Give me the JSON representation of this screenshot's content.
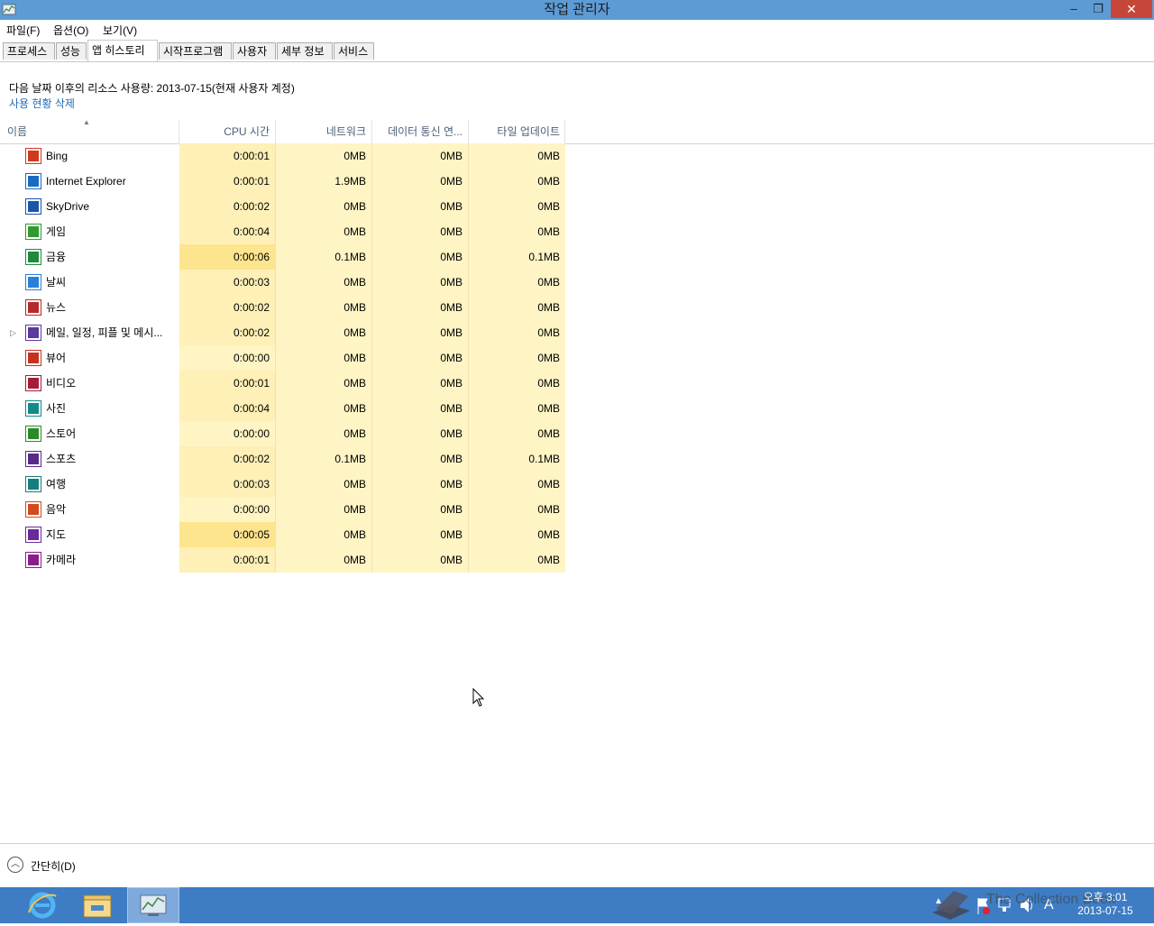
{
  "window": {
    "title": "작업 관리자",
    "min": "–",
    "max": "❐",
    "close": "✕"
  },
  "menu": [
    "파일(F)",
    "옵션(O)",
    "보기(V)"
  ],
  "tabs": [
    "프로세스",
    "성능",
    "앱 히스토리",
    "시작프로그램",
    "사용자",
    "세부 정보",
    "서비스"
  ],
  "active_tab": "앱 히스토리",
  "info_text": "다음 날짜 이후의 리소스 사용량: 2013-07-15(현재 사용자 계정)",
  "delete_link": "사용 현황 삭제",
  "columns": {
    "name": "이름",
    "cpu": "CPU 시간",
    "network": "네트워크",
    "metered": "데이터 통신 연...",
    "tile": "타일 업데이트"
  },
  "rows": [
    {
      "name": "Bing",
      "icon": "bing-icon",
      "color": "#d0391f",
      "cpu": "0:00:01",
      "net": "0MB",
      "data": "0MB",
      "tile": "0MB",
      "heat": 2
    },
    {
      "name": "Internet Explorer",
      "icon": "internet-explorer-icon",
      "color": "#1b6ac2",
      "cpu": "0:00:01",
      "net": "1.9MB",
      "data": "0MB",
      "tile": "0MB",
      "heat": 2
    },
    {
      "name": "SkyDrive",
      "icon": "skydrive-icon",
      "color": "#1a56a8",
      "cpu": "0:00:02",
      "net": "0MB",
      "data": "0MB",
      "tile": "0MB",
      "heat": 2
    },
    {
      "name": "게임",
      "icon": "games-icon",
      "color": "#2f9a2f",
      "cpu": "0:00:04",
      "net": "0MB",
      "data": "0MB",
      "tile": "0MB",
      "heat": 2
    },
    {
      "name": "금융",
      "icon": "finance-icon",
      "color": "#1f8a3c",
      "cpu": "0:00:06",
      "net": "0.1MB",
      "data": "0MB",
      "tile": "0.1MB",
      "heat": 3
    },
    {
      "name": "날씨",
      "icon": "weather-icon",
      "color": "#2b7fd6",
      "cpu": "0:00:03",
      "net": "0MB",
      "data": "0MB",
      "tile": "0MB",
      "heat": 2
    },
    {
      "name": "뉴스",
      "icon": "news-icon",
      "color": "#b32a2a",
      "cpu": "0:00:02",
      "net": "0MB",
      "data": "0MB",
      "tile": "0MB",
      "heat": 2
    },
    {
      "name": "메일, 일정, 피플 및 메시...",
      "icon": "mail-calendar-icon",
      "color": "#5a3a9a",
      "cpu": "0:00:02",
      "net": "0MB",
      "data": "0MB",
      "tile": "0MB",
      "heat": 2,
      "expandable": true
    },
    {
      "name": "뷰어",
      "icon": "reader-icon",
      "color": "#c3331f",
      "cpu": "0:00:00",
      "net": "0MB",
      "data": "0MB",
      "tile": "0MB",
      "heat": 1
    },
    {
      "name": "비디오",
      "icon": "video-icon",
      "color": "#a31d3a",
      "cpu": "0:00:01",
      "net": "0MB",
      "data": "0MB",
      "tile": "0MB",
      "heat": 2
    },
    {
      "name": "사진",
      "icon": "photos-icon",
      "color": "#138a8a",
      "cpu": "0:00:04",
      "net": "0MB",
      "data": "0MB",
      "tile": "0MB",
      "heat": 2
    },
    {
      "name": "스토어",
      "icon": "store-icon",
      "color": "#2a8a2a",
      "cpu": "0:00:00",
      "net": "0MB",
      "data": "0MB",
      "tile": "0MB",
      "heat": 1
    },
    {
      "name": "스포츠",
      "icon": "sports-icon",
      "color": "#5a2a8a",
      "cpu": "0:00:02",
      "net": "0.1MB",
      "data": "0MB",
      "tile": "0.1MB",
      "heat": 2
    },
    {
      "name": "여행",
      "icon": "travel-icon",
      "color": "#167e7e",
      "cpu": "0:00:03",
      "net": "0MB",
      "data": "0MB",
      "tile": "0MB",
      "heat": 2
    },
    {
      "name": "음악",
      "icon": "music-icon",
      "color": "#d24b1e",
      "cpu": "0:00:00",
      "net": "0MB",
      "data": "0MB",
      "tile": "0MB",
      "heat": 1
    },
    {
      "name": "지도",
      "icon": "maps-icon",
      "color": "#6a2a9a",
      "cpu": "0:00:05",
      "net": "0MB",
      "data": "0MB",
      "tile": "0MB",
      "heat": 3
    },
    {
      "name": "카메라",
      "icon": "camera-icon",
      "color": "#8a1f8a",
      "cpu": "0:00:01",
      "net": "0MB",
      "data": "0MB",
      "tile": "0MB",
      "heat": 2
    }
  ],
  "footer": {
    "collapse_label": "간단히(D)"
  },
  "taskbar": {
    "clock_time": "오후 3:01",
    "clock_date": "2013-07-15",
    "ime": "A",
    "watermark": "The Collection Book"
  }
}
